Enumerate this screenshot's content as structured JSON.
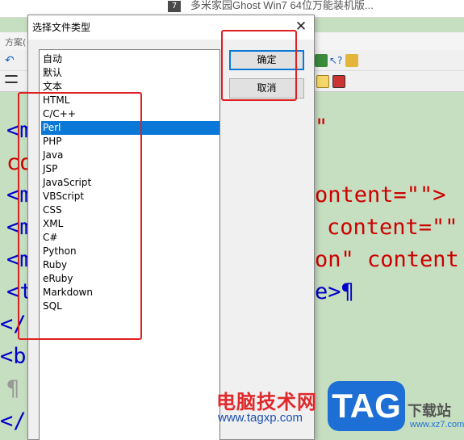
{
  "background_window": {
    "title": "多米家园Ghost Win7 64位万能装机版...",
    "menu_text": "方案(",
    "code_lines": [
      {
        "text": "<m",
        "color": "#0000cc"
      },
      {
        "text": "co",
        "color": "#cc0000"
      },
      {
        "text": "<m",
        "color": "#0000cc"
      },
      {
        "text": "<m",
        "color": "#0000cc"
      },
      {
        "text": "<m",
        "color": "#0000cc"
      },
      {
        "text": "<t",
        "color": "#0000cc"
      },
      {
        "text": "</b",
        "color": "#0000cc"
      },
      {
        "text": "<bo",
        "color": "#0000cc"
      },
      {
        "text": "¶",
        "color": "#999999"
      },
      {
        "text": "</b",
        "color": "#0000cc"
      }
    ],
    "code_right": [
      {
        "text": "\"",
        "color": "#cc0000"
      },
      {
        "text": "ontent=\"\">",
        "color": "#cc0000"
      },
      {
        "text": "content=\"\"",
        "color": "#cc0000"
      },
      {
        "text": "on\" content",
        "color": "#cc0000"
      },
      {
        "text": "e>¶",
        "color": "#0000cc"
      }
    ]
  },
  "dialog": {
    "title": "选择文件类型",
    "close_label": "✕",
    "file_types": [
      "自动",
      "默认",
      "文本",
      "HTML",
      "C/C++",
      "Perl",
      "PHP",
      "Java",
      "JSP",
      "JavaScript",
      "VBScript",
      "CSS",
      "XML",
      "C#",
      "Python",
      "Ruby",
      "eRuby",
      "Markdown",
      "SQL"
    ],
    "selected_index": 5,
    "ok_label": "确定",
    "cancel_label": "取消"
  },
  "watermark": {
    "site_name": "电脑技术网",
    "url": "www.tagxp.com",
    "logo_text": "TAG",
    "download_text": "下载站",
    "download_url": "www.xz7.com"
  },
  "colors": {
    "selection": "#0a78d7",
    "annotation": "#e02020",
    "editor_bg": "#c7dfc1"
  }
}
